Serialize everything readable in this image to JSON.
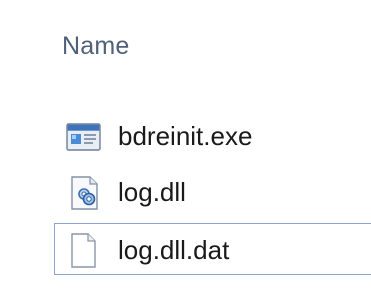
{
  "column_header": {
    "name_label": "Name"
  },
  "files": [
    {
      "name": "bdreinit.exe",
      "icon": "executable-icon",
      "focused": false
    },
    {
      "name": "log.dll",
      "icon": "dll-settings-icon",
      "focused": false
    },
    {
      "name": "log.dll.dat",
      "icon": "blank-document-icon",
      "focused": true
    }
  ],
  "colors": {
    "header_text": "#4f6078",
    "file_text": "#1a1a1a",
    "focus_border": "#8aa6cc"
  }
}
